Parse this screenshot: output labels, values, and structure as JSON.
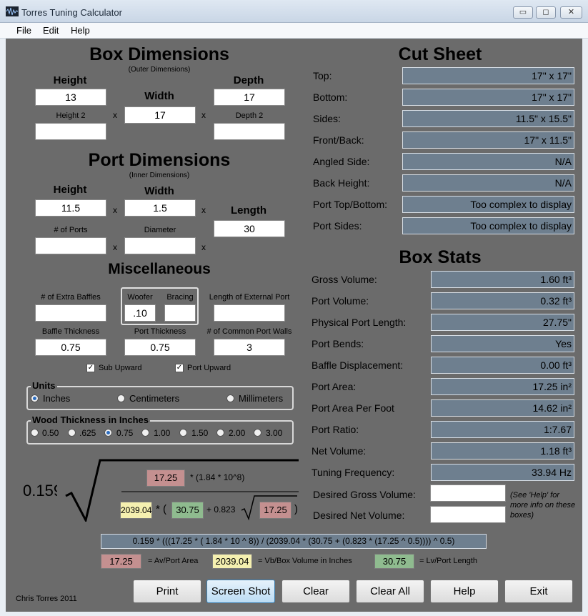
{
  "window": {
    "title": "Torres Tuning Calculator",
    "min": "▭",
    "max": "◻",
    "close": "✕"
  },
  "menu": [
    "File",
    "Edit",
    "Help"
  ],
  "box": {
    "title": "Box Dimensions",
    "subtitle": "(Outer Dimensions)",
    "height_label": "Height",
    "width_label": "Width",
    "depth_label": "Depth",
    "height2_label": "Height 2",
    "depth2_label": "Depth 2",
    "height": "13",
    "width": "17",
    "depth": "17",
    "height2": "",
    "depth2": ""
  },
  "port": {
    "title": "Port Dimensions",
    "subtitle": "(Inner Dimensions)",
    "height_label": "Height",
    "width_label": "Width",
    "length_label": "Length",
    "ports_label": "# of Ports",
    "diameter_label": "Diameter",
    "height": "11.5",
    "width": "1.5",
    "length": "30",
    "ports": "",
    "diameter": ""
  },
  "misc": {
    "title": "Miscellaneous",
    "extra_baffles_label": "# of Extra Baffles",
    "woofer_label": "Woofer",
    "bracing_label": "Bracing",
    "ext_port_label": "Length of External Port",
    "baffle_thick_label": "Baffle Thickness",
    "port_thick_label": "Port Thickness",
    "common_walls_label": "# of Common Port Walls",
    "extra_baffles": "",
    "woofer": ".10",
    "bracing": "",
    "ext_port": "",
    "baffle_thick": "0.75",
    "port_thick": "0.75",
    "common_walls": "3",
    "sub_upward": "Sub Upward",
    "port_upward": "Port Upward"
  },
  "units": {
    "title": "Units",
    "options": [
      "Inches",
      "Centimeters",
      "Millimeters"
    ],
    "selected": "Inches"
  },
  "wood": {
    "title": "Wood Thickness in Inches",
    "options": [
      "0.50",
      ".625",
      "0.75",
      "1.00",
      "1.50",
      "2.00",
      "3.00"
    ],
    "selected": "0.75"
  },
  "cut_sheet": {
    "title": "Cut Sheet",
    "rows": [
      {
        "label": "Top:",
        "value": "17\" x 17\""
      },
      {
        "label": "Bottom:",
        "value": "17\" x 17\""
      },
      {
        "label": "Sides:",
        "value": "11.5\" x 15.5\""
      },
      {
        "label": "Front/Back:",
        "value": "17\" x 11.5\""
      },
      {
        "label": "Angled Side:",
        "value": "N/A"
      },
      {
        "label": "Back Height:",
        "value": "N/A"
      },
      {
        "label": "Port Top/Bottom:",
        "value": "Too complex to display"
      },
      {
        "label": "Port Sides:",
        "value": "Too complex to display"
      }
    ]
  },
  "stats": {
    "title": "Box Stats",
    "rows": [
      {
        "label": "Gross Volume:",
        "value": "1.60 ft³"
      },
      {
        "label": "Port Volume:",
        "value": "0.32 ft³"
      },
      {
        "label": "Physical Port Length:",
        "value": "27.75\""
      },
      {
        "label": "Port Bends:",
        "value": "Yes"
      },
      {
        "label": "Baffle Displacement:",
        "value": "0.00 ft³"
      },
      {
        "label": "Port Area:",
        "value": "17.25 in²"
      },
      {
        "label": "Port Area Per Foot",
        "value": "14.62 in²"
      },
      {
        "label": "Port Ratio:",
        "value": "1:7.67"
      },
      {
        "label": "Net Volume:",
        "value": "1.18 ft³"
      },
      {
        "label": "Tuning Frequency:",
        "value": "33.94 Hz"
      }
    ],
    "desired_gross_label": "Desired Gross Volume:",
    "desired_net_label": "Desired Net Volume:",
    "desired_gross": "",
    "desired_net": "",
    "note": "(See 'Help' for more info on these boxes)"
  },
  "formula": {
    "coef": "0.159",
    "num_box": "17.25",
    "num_text": "* (1.84 * 10^8)",
    "den_vb": "2039.04",
    "den_star": "* (",
    "den_lv": "30.75",
    "den_plus": "+ 0.823",
    "den_av": "17.25",
    "den_close": ")",
    "full": "0.159 * (((17.25 * ( 1.84 * 10 ^ 8)) / (2039.04 * (30.75 + (0.823 * (17.25 ^ 0.5)))) ^ 0.5)"
  },
  "legend": [
    {
      "value": "17.25",
      "label": "= Av/Port Area"
    },
    {
      "value": "2039.04",
      "label": "= Vb/Box Volume in Inches"
    },
    {
      "value": "30.75",
      "label": "= Lv/Port Length"
    }
  ],
  "credit": "Chris Torres 2011",
  "buttons": [
    "Print",
    "Screen Shot",
    "Clear",
    "Clear All",
    "Help",
    "Exit"
  ],
  "colors": {
    "panel": "#6b6b6b",
    "readout": "#6e7f8f",
    "pink": "#c49090",
    "yellow": "#f5f0b0",
    "green": "#8fbb8f"
  }
}
